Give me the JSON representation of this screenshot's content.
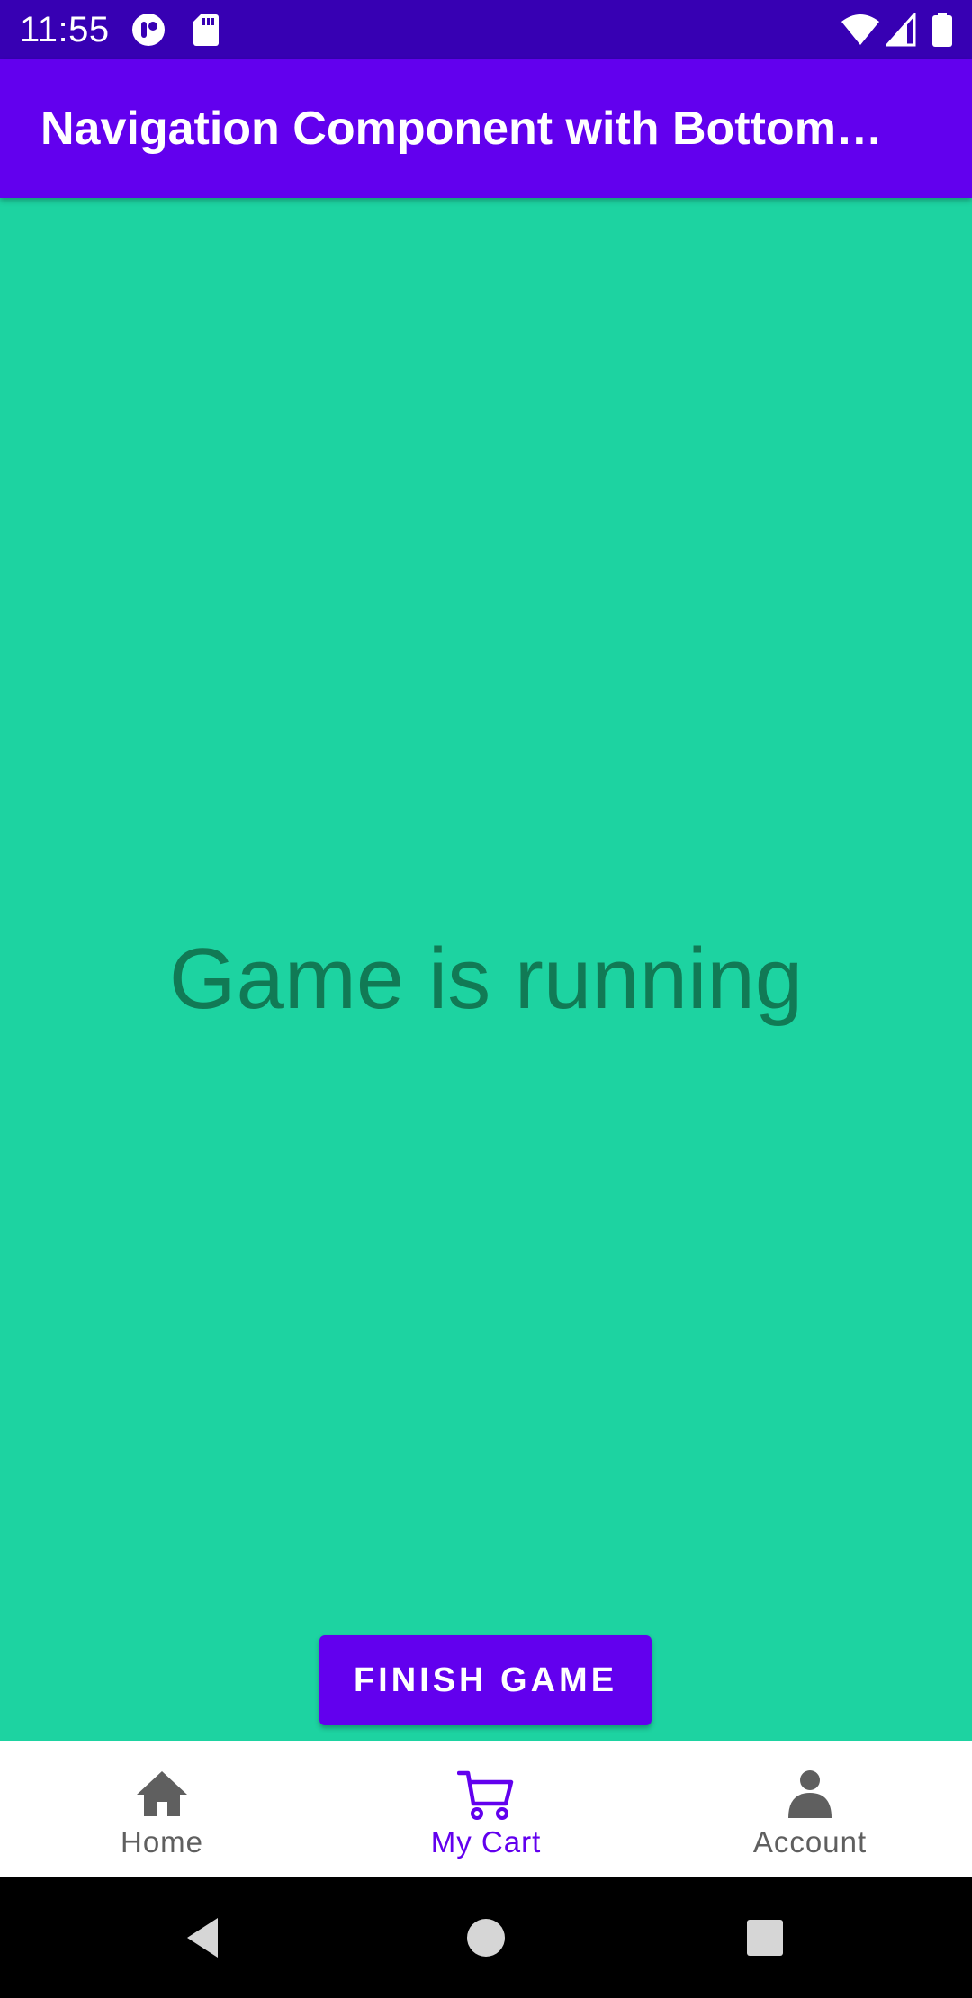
{
  "status_bar": {
    "time": "11:55",
    "left_icons": [
      "notification-app-icon",
      "sd-card-icon"
    ],
    "right_icons": [
      "wifi-icon",
      "cellular-signal-icon",
      "battery-icon"
    ]
  },
  "app_bar": {
    "title": "Navigation Component with Bottom…"
  },
  "main": {
    "status_text": "Game is running",
    "finish_button_label": "FINISH GAME"
  },
  "bottom_nav": {
    "items": [
      {
        "label": "Home",
        "icon": "home-icon",
        "selected": false
      },
      {
        "label": "My Cart",
        "icon": "cart-icon",
        "selected": true
      },
      {
        "label": "Account",
        "icon": "account-icon",
        "selected": false
      }
    ]
  },
  "system_nav": {
    "buttons": [
      "back-icon",
      "home-circle-icon",
      "recents-icon"
    ]
  },
  "colors": {
    "status_bar": "#3700b3",
    "app_bar": "#6200ee",
    "content_background": "#1dd3a1",
    "status_text": "#117a55",
    "nav_selected": "#6200ee",
    "nav_unselected": "#5f5f5f",
    "system_nav": "#000000"
  }
}
